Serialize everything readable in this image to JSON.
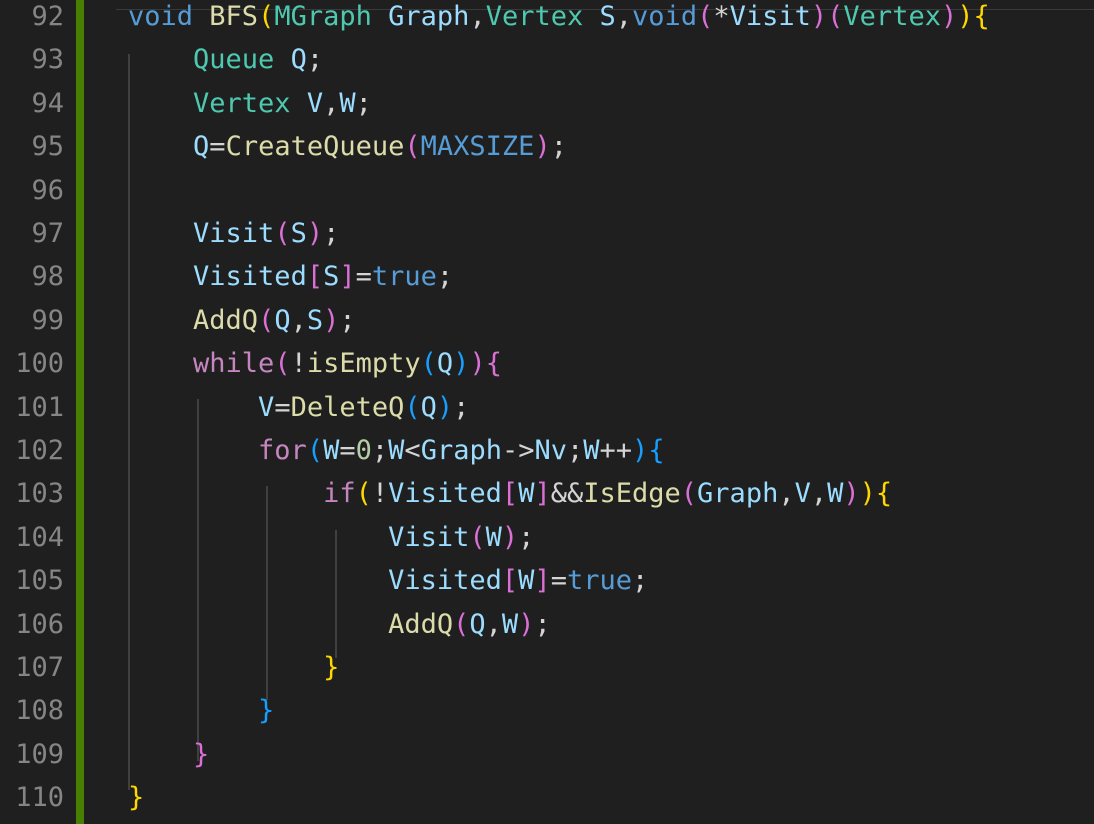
{
  "editor": {
    "language": "C",
    "colors": {
      "background": "#1f1f1f",
      "line_number": "#858585",
      "git_modified_bar": "#487e02",
      "indent_guide": "#404040",
      "keyword": "#569cd6",
      "control": "#c586c0",
      "type": "#4ec9b0",
      "function": "#dcdcaa",
      "variable": "#9cdcfe",
      "constant": "#4fc1ff",
      "number": "#b5cea8",
      "bracket_level1": "#ffd700",
      "bracket_level2": "#da70d6",
      "bracket_level3": "#179fff"
    },
    "line_numbers": [
      "92",
      "93",
      "94",
      "95",
      "96",
      "97",
      "98",
      "99",
      "100",
      "101",
      "102",
      "103",
      "104",
      "105",
      "106",
      "107",
      "108",
      "109",
      "110"
    ],
    "lines": [
      {
        "n": "92",
        "tokens": [
          [
            "void",
            "kw"
          ],
          [
            " ",
            "op"
          ],
          [
            "BFS",
            "fn"
          ],
          [
            "(",
            "br1"
          ],
          [
            "MGraph",
            "type"
          ],
          [
            " ",
            "op"
          ],
          [
            "Graph",
            "var"
          ],
          [
            ",",
            "op"
          ],
          [
            "Vertex",
            "type"
          ],
          [
            " ",
            "op"
          ],
          [
            "S",
            "var"
          ],
          [
            ",",
            "op"
          ],
          [
            "void",
            "kw"
          ],
          [
            "(",
            "br2"
          ],
          [
            "*",
            "op"
          ],
          [
            "Visit",
            "var"
          ],
          [
            ")",
            "br2"
          ],
          [
            "(",
            "br2"
          ],
          [
            "Vertex",
            "type"
          ],
          [
            ")",
            "br2"
          ],
          [
            ")",
            "br1"
          ],
          [
            "{",
            "br1"
          ]
        ]
      },
      {
        "n": "93",
        "tokens": [
          [
            "    ",
            "op"
          ],
          [
            "Queue",
            "type"
          ],
          [
            " ",
            "op"
          ],
          [
            "Q",
            "var"
          ],
          [
            ";",
            "op"
          ]
        ]
      },
      {
        "n": "94",
        "tokens": [
          [
            "    ",
            "op"
          ],
          [
            "Vertex",
            "type"
          ],
          [
            " ",
            "op"
          ],
          [
            "V",
            "var"
          ],
          [
            ",",
            "op"
          ],
          [
            "W",
            "var"
          ],
          [
            ";",
            "op"
          ]
        ]
      },
      {
        "n": "95",
        "tokens": [
          [
            "    ",
            "op"
          ],
          [
            "Q",
            "var"
          ],
          [
            "=",
            "op"
          ],
          [
            "CreateQueue",
            "fn"
          ],
          [
            "(",
            "br2"
          ],
          [
            "MAXSIZE",
            "kw"
          ],
          [
            ")",
            "br2"
          ],
          [
            ";",
            "op"
          ]
        ]
      },
      {
        "n": "96",
        "tokens": []
      },
      {
        "n": "97",
        "tokens": [
          [
            "    ",
            "op"
          ],
          [
            "Visit",
            "var"
          ],
          [
            "(",
            "br2"
          ],
          [
            "S",
            "var"
          ],
          [
            ")",
            "br2"
          ],
          [
            ";",
            "op"
          ]
        ]
      },
      {
        "n": "98",
        "tokens": [
          [
            "    ",
            "op"
          ],
          [
            "Visited",
            "var"
          ],
          [
            "[",
            "br2"
          ],
          [
            "S",
            "var"
          ],
          [
            "]",
            "br2"
          ],
          [
            "=",
            "op"
          ],
          [
            "true",
            "kw"
          ],
          [
            ";",
            "op"
          ]
        ]
      },
      {
        "n": "99",
        "tokens": [
          [
            "    ",
            "op"
          ],
          [
            "AddQ",
            "fn"
          ],
          [
            "(",
            "br2"
          ],
          [
            "Q",
            "var"
          ],
          [
            ",",
            "op"
          ],
          [
            "S",
            "var"
          ],
          [
            ")",
            "br2"
          ],
          [
            ";",
            "op"
          ]
        ]
      },
      {
        "n": "100",
        "tokens": [
          [
            "    ",
            "op"
          ],
          [
            "while",
            "ctl"
          ],
          [
            "(",
            "br2"
          ],
          [
            "!",
            "op"
          ],
          [
            "isEmpty",
            "fn"
          ],
          [
            "(",
            "br3"
          ],
          [
            "Q",
            "var"
          ],
          [
            ")",
            "br3"
          ],
          [
            ")",
            "br2"
          ],
          [
            "{",
            "br2"
          ]
        ]
      },
      {
        "n": "101",
        "tokens": [
          [
            "        ",
            "op"
          ],
          [
            "V",
            "var"
          ],
          [
            "=",
            "op"
          ],
          [
            "DeleteQ",
            "fn"
          ],
          [
            "(",
            "br3"
          ],
          [
            "Q",
            "var"
          ],
          [
            ")",
            "br3"
          ],
          [
            ";",
            "op"
          ]
        ]
      },
      {
        "n": "102",
        "tokens": [
          [
            "        ",
            "op"
          ],
          [
            "for",
            "ctl"
          ],
          [
            "(",
            "br3"
          ],
          [
            "W",
            "var"
          ],
          [
            "=",
            "op"
          ],
          [
            "0",
            "num"
          ],
          [
            ";",
            "op"
          ],
          [
            "W",
            "var"
          ],
          [
            "<",
            "op"
          ],
          [
            "Graph",
            "var"
          ],
          [
            "->",
            "op"
          ],
          [
            "Nv",
            "var"
          ],
          [
            ";",
            "op"
          ],
          [
            "W",
            "var"
          ],
          [
            "++",
            "op"
          ],
          [
            ")",
            "br3"
          ],
          [
            "{",
            "br3"
          ]
        ]
      },
      {
        "n": "103",
        "tokens": [
          [
            "            ",
            "op"
          ],
          [
            "if",
            "ctl"
          ],
          [
            "(",
            "br1"
          ],
          [
            "!",
            "op"
          ],
          [
            "Visited",
            "var"
          ],
          [
            "[",
            "br2"
          ],
          [
            "W",
            "var"
          ],
          [
            "]",
            "br2"
          ],
          [
            "&&",
            "op"
          ],
          [
            "IsEdge",
            "fn"
          ],
          [
            "(",
            "br2"
          ],
          [
            "Graph",
            "var"
          ],
          [
            ",",
            "op"
          ],
          [
            "V",
            "var"
          ],
          [
            ",",
            "op"
          ],
          [
            "W",
            "var"
          ],
          [
            ")",
            "br2"
          ],
          [
            ")",
            "br1"
          ],
          [
            "{",
            "br1"
          ]
        ]
      },
      {
        "n": "104",
        "tokens": [
          [
            "                ",
            "op"
          ],
          [
            "Visit",
            "var"
          ],
          [
            "(",
            "br2"
          ],
          [
            "W",
            "var"
          ],
          [
            ")",
            "br2"
          ],
          [
            ";",
            "op"
          ]
        ]
      },
      {
        "n": "105",
        "tokens": [
          [
            "                ",
            "op"
          ],
          [
            "Visited",
            "var"
          ],
          [
            "[",
            "br2"
          ],
          [
            "W",
            "var"
          ],
          [
            "]",
            "br2"
          ],
          [
            "=",
            "op"
          ],
          [
            "true",
            "kw"
          ],
          [
            ";",
            "op"
          ]
        ]
      },
      {
        "n": "106",
        "tokens": [
          [
            "                ",
            "op"
          ],
          [
            "AddQ",
            "fn"
          ],
          [
            "(",
            "br2"
          ],
          [
            "Q",
            "var"
          ],
          [
            ",",
            "op"
          ],
          [
            "W",
            "var"
          ],
          [
            ")",
            "br2"
          ],
          [
            ";",
            "op"
          ]
        ]
      },
      {
        "n": "107",
        "tokens": [
          [
            "            ",
            "op"
          ],
          [
            "}",
            "br1"
          ]
        ]
      },
      {
        "n": "108",
        "tokens": [
          [
            "        ",
            "op"
          ],
          [
            "}",
            "br3"
          ]
        ]
      },
      {
        "n": "109",
        "tokens": [
          [
            "    ",
            "op"
          ],
          [
            "}",
            "br2"
          ]
        ]
      },
      {
        "n": "110",
        "tokens": [
          [
            "}",
            "br1"
          ]
        ]
      }
    ]
  }
}
